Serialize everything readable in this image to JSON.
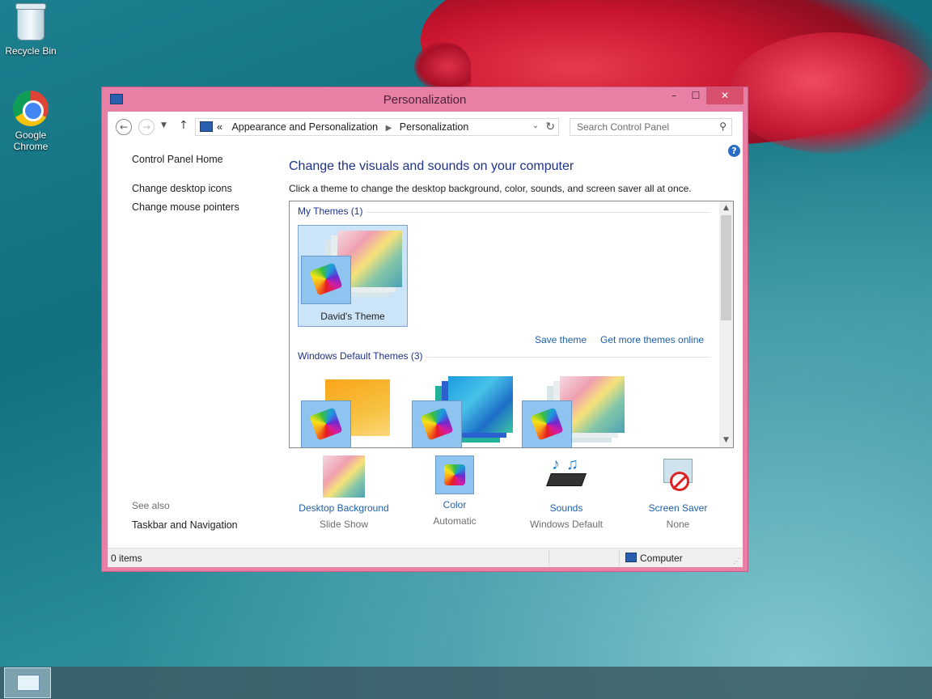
{
  "desktop": {
    "icons": [
      {
        "label": "Recycle Bin"
      },
      {
        "label": "Google Chrome"
      }
    ]
  },
  "window": {
    "title": "Personalization",
    "controls": {
      "minimize": "–",
      "maximize": "☐",
      "close": "✕"
    }
  },
  "address_bar": {
    "overflow": "«",
    "crumbs": [
      "Appearance and Personalization",
      "Personalization"
    ]
  },
  "search": {
    "placeholder": "Search Control Panel"
  },
  "left_pane": {
    "home": "Control Panel Home",
    "links": [
      "Change desktop icons",
      "Change mouse pointers"
    ],
    "see_also_label": "See also",
    "see_also_links": [
      "Taskbar and Navigation"
    ]
  },
  "main": {
    "heading": "Change the visuals and sounds on your computer",
    "subheading": "Click a theme to change the desktop background, color, sounds, and screen saver all at once.",
    "help": "?"
  },
  "themes": {
    "my_themes_label": "My Themes (1)",
    "my_themes": [
      {
        "name": "David's Theme",
        "selected": true
      }
    ],
    "save_theme": "Save theme",
    "get_more": "Get more themes online",
    "default_label": "Windows Default Themes (3)"
  },
  "bottom": [
    {
      "label": "Desktop Background",
      "value": "Slide Show",
      "icon": "desktop-background-icon"
    },
    {
      "label": "Color",
      "value": "Automatic",
      "icon": "color-icon"
    },
    {
      "label": "Sounds",
      "value": "Windows Default",
      "icon": "sounds-icon"
    },
    {
      "label": "Screen Saver",
      "value": "None",
      "icon": "screen-saver-icon"
    }
  ],
  "status_bar": {
    "items": "0 items",
    "location": "Computer"
  },
  "colors": {
    "window_frame": "#e87fa4",
    "close_button": "#d9506f",
    "link": "#1e5fa8",
    "heading": "#1e3287"
  }
}
